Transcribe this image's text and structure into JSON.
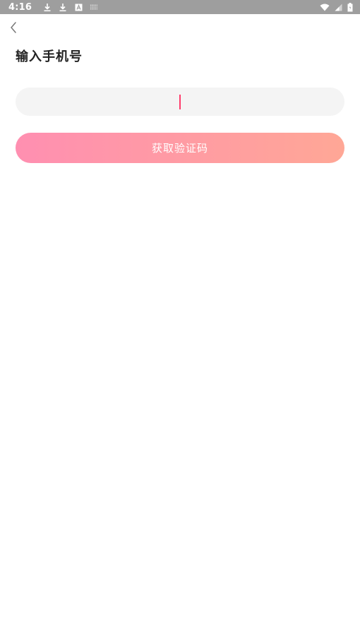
{
  "status_bar": {
    "time": "4:16",
    "left_icons": [
      "download-icon",
      "download-icon",
      "a-icon",
      "cast-icon"
    ],
    "right_icons": [
      "wifi-icon",
      "signal-icon",
      "battery-icon"
    ]
  },
  "nav": {
    "back_icon": "chevron-left-icon"
  },
  "page": {
    "title": "输入手机号"
  },
  "phone_input": {
    "value": "",
    "placeholder": ""
  },
  "get_code_button": {
    "label": "获取验证码"
  },
  "colors": {
    "status_bar_bg": "#9e9e9e",
    "input_bg": "#f4f4f4",
    "cursor": "#ff3b6b",
    "button_gradient_start": "#ff8fb1",
    "button_gradient_end": "#ffa796",
    "title_text": "#222222"
  }
}
